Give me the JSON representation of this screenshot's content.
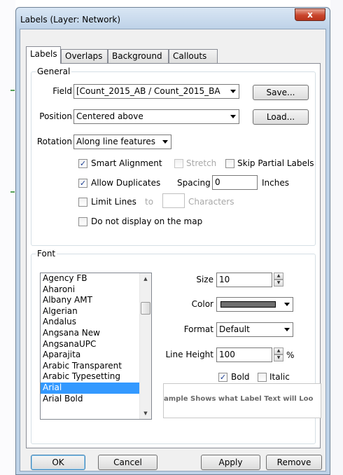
{
  "window": {
    "title": "Labels (Layer: Network)",
    "close_glyph": "x"
  },
  "tabs": [
    {
      "label": "Labels",
      "active": true
    },
    {
      "label": "Overlaps",
      "active": false
    },
    {
      "label": "Background",
      "active": false
    },
    {
      "label": "Callouts",
      "active": false
    }
  ],
  "general": {
    "legend": "General",
    "field_label": "Field",
    "field_value": "[Count_2015_AB / Count_2015_BA",
    "position_label": "Position",
    "position_value": "Centered above",
    "rotation_label": "Rotation",
    "rotation_value": "Along line features",
    "save_label": "Save...",
    "load_label": "Load...",
    "smart_alignment": {
      "label": "Smart Alignment",
      "checked": true
    },
    "stretch": {
      "label": "Stretch",
      "checked": false,
      "enabled": false
    },
    "skip_partial": {
      "label": "Skip Partial Labels",
      "checked": false
    },
    "allow_duplicates": {
      "label": "Allow Duplicates",
      "checked": true
    },
    "spacing_label": "Spacing",
    "spacing_value": "0",
    "spacing_units": "Inches",
    "limit_lines": {
      "label": "Limit Lines",
      "checked": false
    },
    "limit_to_label": "to",
    "characters_label": "Characters",
    "do_not_display": {
      "label": "Do not display on the map",
      "checked": false
    }
  },
  "font": {
    "legend": "Font",
    "list": [
      "Agency FB",
      "Aharoni",
      "Albany AMT",
      "Algerian",
      "Andalus",
      "Angsana New",
      "AngsanaUPC",
      "Aparajita",
      "Arabic Transparent",
      "Arabic Typesetting",
      "Arial",
      "Arial Bold"
    ],
    "selected": "Arial",
    "size_label": "Size",
    "size_value": "10",
    "color_label": "Color",
    "color_value": "#6f6f6f",
    "format_label": "Format",
    "format_value": "Default",
    "line_height_label": "Line Height",
    "line_height_value": "100",
    "line_height_unit": "%",
    "bold": {
      "label": "Bold",
      "checked": true
    },
    "italic": {
      "label": "Italic",
      "checked": false
    },
    "preview_text": "ample Shows what Label Text will Loo"
  },
  "buttons": {
    "ok": "OK",
    "cancel": "Cancel",
    "apply": "Apply",
    "remove": "Remove"
  },
  "check_glyph": "✓"
}
